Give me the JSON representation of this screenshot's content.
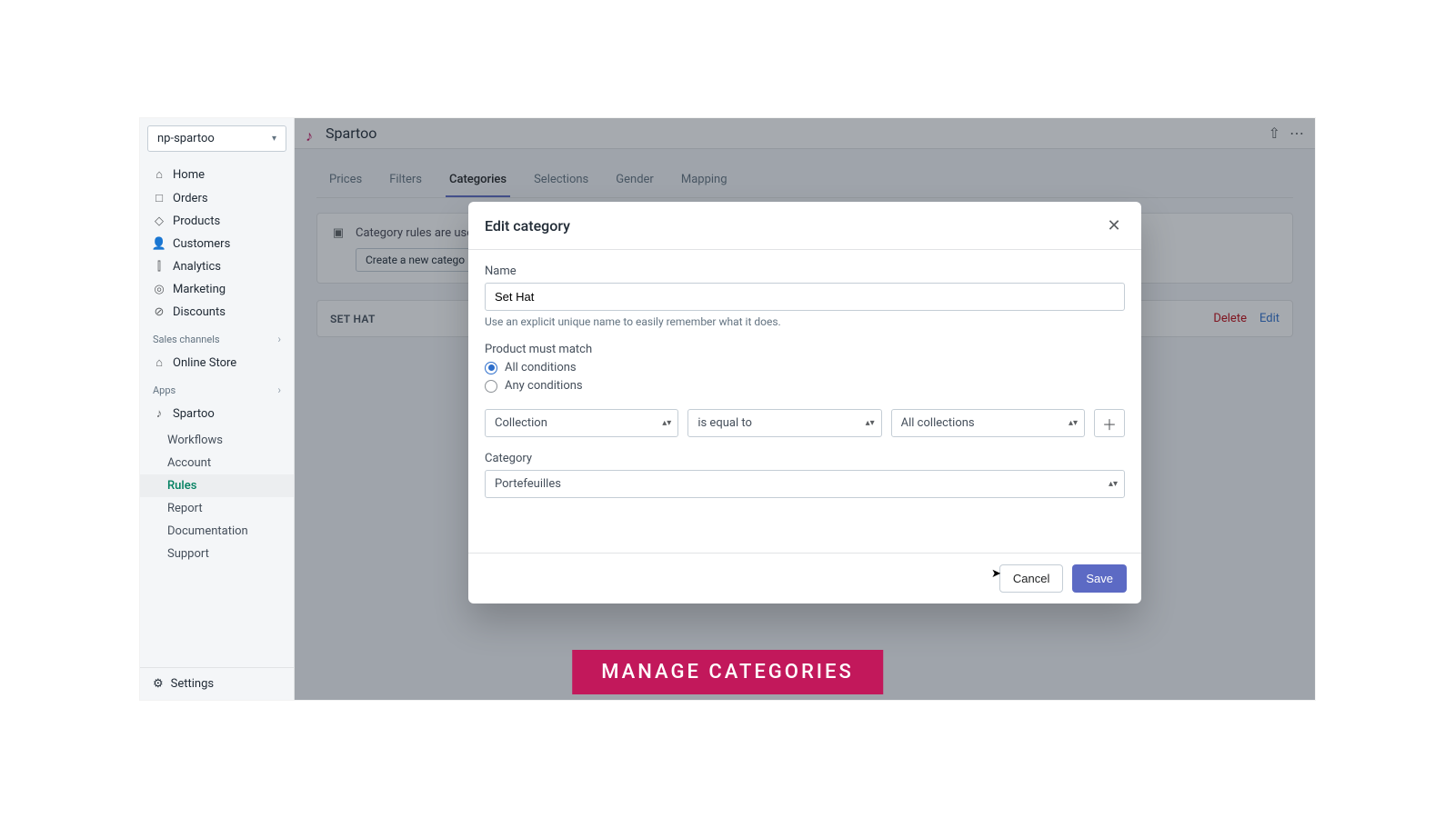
{
  "store_switcher": {
    "name": "np-spartoo"
  },
  "sidebar": {
    "items": [
      {
        "icon": "home-icon",
        "glyph": "⌂",
        "label": "Home"
      },
      {
        "icon": "orders-icon",
        "glyph": "□",
        "label": "Orders"
      },
      {
        "icon": "products-icon",
        "glyph": "◇",
        "label": "Products"
      },
      {
        "icon": "customers-icon",
        "glyph": "👤",
        "label": "Customers"
      },
      {
        "icon": "analytics-icon",
        "glyph": "⫿",
        "label": "Analytics"
      },
      {
        "icon": "marketing-icon",
        "glyph": "◎",
        "label": "Marketing"
      },
      {
        "icon": "discounts-icon",
        "glyph": "⊘",
        "label": "Discounts"
      }
    ],
    "sales_channels_label": "Sales channels",
    "online_store": {
      "glyph": "⌂",
      "label": "Online Store"
    },
    "apps_label": "Apps",
    "app": {
      "glyph": "♪",
      "label": "Spartoo"
    },
    "app_sub": [
      {
        "label": "Workflows",
        "active": false
      },
      {
        "label": "Account",
        "active": false
      },
      {
        "label": "Rules",
        "active": true
      },
      {
        "label": "Report",
        "active": false
      },
      {
        "label": "Documentation",
        "active": false
      },
      {
        "label": "Support",
        "active": false
      }
    ],
    "settings": {
      "glyph": "⚙",
      "label": "Settings"
    }
  },
  "header": {
    "brand_glyph": "♪",
    "brand_name": "Spartoo",
    "pin_glyph": "⇧",
    "more_glyph": "⋯"
  },
  "tabs": [
    {
      "label": "Prices",
      "active": false
    },
    {
      "label": "Filters",
      "active": false
    },
    {
      "label": "Categories",
      "active": true
    },
    {
      "label": "Selections",
      "active": false
    },
    {
      "label": "Gender",
      "active": false
    },
    {
      "label": "Mapping",
      "active": false
    }
  ],
  "notice": {
    "text": "Category rules are use",
    "button": "Create a new catego"
  },
  "rule_row": {
    "name": "SET HAT",
    "delete": "Delete",
    "edit": "Edit"
  },
  "modal": {
    "title": "Edit category",
    "name_label": "Name",
    "name_value": "Set Hat",
    "name_help": "Use an explicit unique name to easily remember what it does.",
    "match_label": "Product must match",
    "radio_all": "All conditions",
    "radio_any": "Any conditions",
    "condition": {
      "field": "Collection",
      "operator": "is equal to",
      "value": "All collections"
    },
    "category_label": "Category",
    "category_value": "Portefeuilles",
    "cancel": "Cancel",
    "save": "Save"
  },
  "caption": "MANAGE  CATEGORIES"
}
